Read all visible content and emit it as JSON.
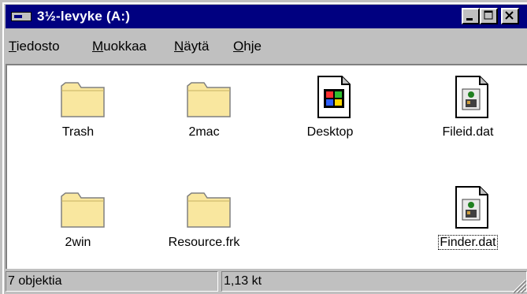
{
  "window": {
    "title": "3½-levyke (A:)"
  },
  "menubar": {
    "items": [
      "Tiedosto",
      "Muokkaa",
      "Näytä",
      "Ohje"
    ]
  },
  "items": [
    {
      "label": "Trash",
      "icon": "folder-icon"
    },
    {
      "label": "2mac",
      "icon": "folder-icon"
    },
    {
      "label": "Desktop",
      "icon": "windows-file-icon"
    },
    {
      "label": "Fileid.dat",
      "icon": "dat-file-icon"
    },
    {
      "label": "2win",
      "icon": "folder-icon"
    },
    {
      "label": "Resource.frk",
      "icon": "folder-icon"
    },
    {
      "label": "Finder.dat",
      "icon": "dat-file-icon",
      "focused": true
    }
  ],
  "statusbar": {
    "objects": "7 objektia",
    "size": "1,13 kt"
  },
  "colors": {
    "titlebar": "#000080",
    "face": "#c0c0c0",
    "folder": "#f9e79f",
    "desktop_bg": "#f9d38e"
  }
}
